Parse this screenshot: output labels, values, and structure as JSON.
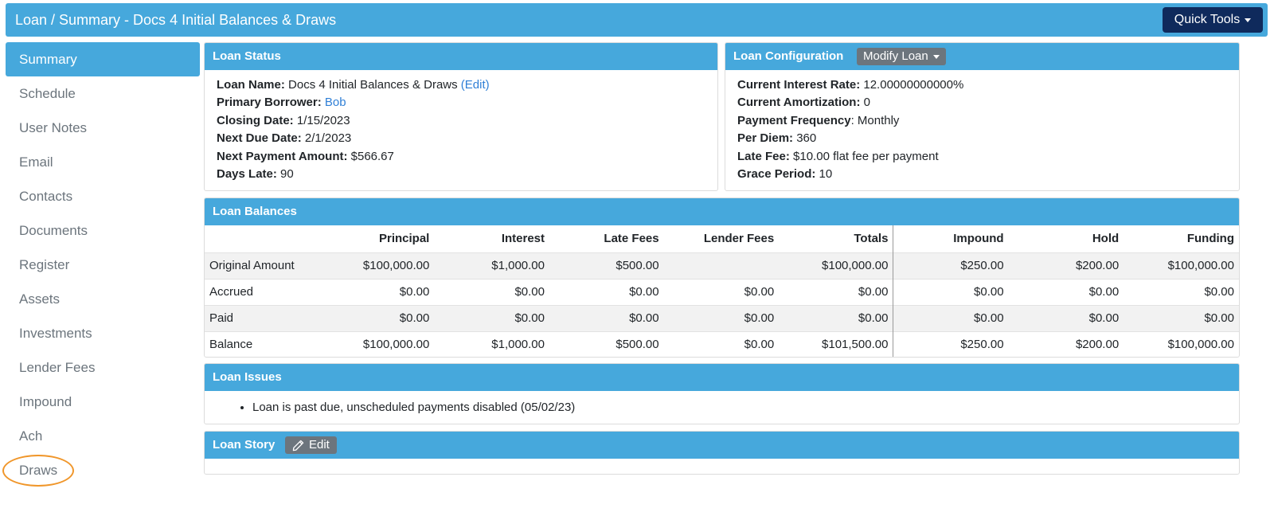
{
  "header": {
    "title": "Loan / Summary - Docs 4 Initial Balances & Draws",
    "quick_tools_label": "Quick Tools"
  },
  "sidebar": {
    "items": [
      {
        "label": "Summary"
      },
      {
        "label": "Schedule"
      },
      {
        "label": "User Notes"
      },
      {
        "label": "Email"
      },
      {
        "label": "Contacts"
      },
      {
        "label": "Documents"
      },
      {
        "label": "Register"
      },
      {
        "label": "Assets"
      },
      {
        "label": "Investments"
      },
      {
        "label": "Lender Fees"
      },
      {
        "label": "Impound"
      },
      {
        "label": "Ach"
      },
      {
        "label": "Draws"
      }
    ]
  },
  "loan_status": {
    "title": "Loan Status",
    "loan_name_label": "Loan Name:",
    "loan_name": "Docs 4 Initial Balances & Draws",
    "edit_link": "(Edit)",
    "primary_borrower_label": "Primary Borrower:",
    "primary_borrower": "Bob",
    "closing_date_label": "Closing Date:",
    "closing_date": "1/15/2023",
    "next_due_label": "Next Due Date:",
    "next_due": "2/1/2023",
    "next_payment_label": "Next Payment Amount:",
    "next_payment": "$566.67",
    "days_late_label": "Days Late:",
    "days_late": "90"
  },
  "loan_config": {
    "title": "Loan Configuration",
    "modify_label": "Modify Loan",
    "interest_rate_label": "Current Interest Rate:",
    "interest_rate": "12.00000000000%",
    "amortization_label": "Current Amortization:",
    "amortization": "0",
    "payment_frequency_label": "Payment Frequency",
    "payment_frequency": ": Monthly",
    "per_diem_label": "Per Diem:",
    "per_diem": "360",
    "late_fee_label": "Late Fee:",
    "late_fee": "$10.00 flat fee per payment",
    "grace_period_label": "Grace Period:",
    "grace_period": "10"
  },
  "loan_balances": {
    "title": "Loan Balances",
    "columns": [
      "",
      "Principal",
      "Interest",
      "Late Fees",
      "Lender Fees",
      "Totals",
      "Impound",
      "Hold",
      "Funding"
    ],
    "rows": [
      [
        "Original Amount",
        "$100,000.00",
        "$1,000.00",
        "$500.00",
        "",
        "$100,000.00",
        "$250.00",
        "$200.00",
        "$100,000.00"
      ],
      [
        "Accrued",
        "$0.00",
        "$0.00",
        "$0.00",
        "$0.00",
        "$0.00",
        "$0.00",
        "$0.00",
        "$0.00"
      ],
      [
        "Paid",
        "$0.00",
        "$0.00",
        "$0.00",
        "$0.00",
        "$0.00",
        "$0.00",
        "$0.00",
        "$0.00"
      ],
      [
        "Balance",
        "$100,000.00",
        "$1,000.00",
        "$500.00",
        "$0.00",
        "$101,500.00",
        "$250.00",
        "$200.00",
        "$100,000.00"
      ]
    ]
  },
  "loan_issues": {
    "title": "Loan Issues",
    "items": [
      "Loan is past due, unscheduled payments disabled (05/02/23)"
    ]
  },
  "loan_story": {
    "title": "Loan Story",
    "edit_label": "Edit"
  },
  "icons": {
    "pencil": "pencil-icon",
    "caret": "caret-down-icon"
  },
  "colors": {
    "accent": "#46a8dc",
    "quick_tools": "#0f2a5c",
    "button_gray": "#6c757d",
    "link": "#2f7fd6",
    "highlight_circle": "#f0962a"
  }
}
